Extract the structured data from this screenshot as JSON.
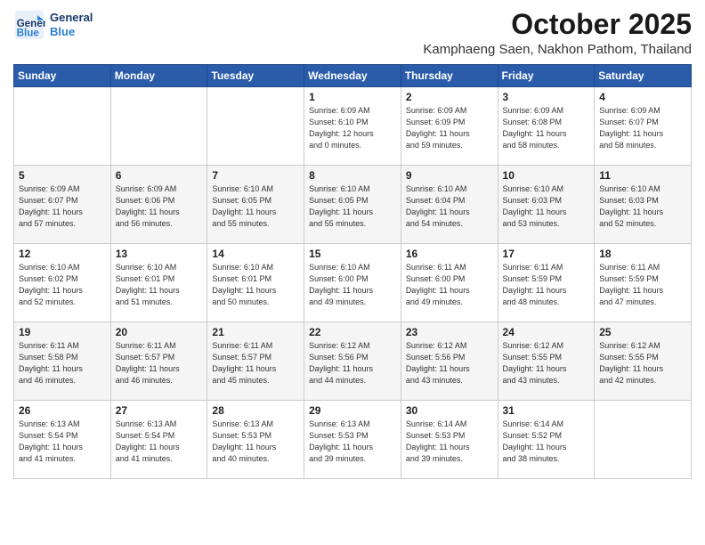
{
  "header": {
    "logo_line1": "General",
    "logo_line2": "Blue",
    "title": "October 2025",
    "subtitle": "Kamphaeng Saen, Nakhon Pathom, Thailand"
  },
  "weekdays": [
    "Sunday",
    "Monday",
    "Tuesday",
    "Wednesday",
    "Thursday",
    "Friday",
    "Saturday"
  ],
  "weeks": [
    [
      {
        "num": "",
        "info": ""
      },
      {
        "num": "",
        "info": ""
      },
      {
        "num": "",
        "info": ""
      },
      {
        "num": "1",
        "info": "Sunrise: 6:09 AM\nSunset: 6:10 PM\nDaylight: 12 hours\nand 0 minutes."
      },
      {
        "num": "2",
        "info": "Sunrise: 6:09 AM\nSunset: 6:09 PM\nDaylight: 11 hours\nand 59 minutes."
      },
      {
        "num": "3",
        "info": "Sunrise: 6:09 AM\nSunset: 6:08 PM\nDaylight: 11 hours\nand 58 minutes."
      },
      {
        "num": "4",
        "info": "Sunrise: 6:09 AM\nSunset: 6:07 PM\nDaylight: 11 hours\nand 58 minutes."
      }
    ],
    [
      {
        "num": "5",
        "info": "Sunrise: 6:09 AM\nSunset: 6:07 PM\nDaylight: 11 hours\nand 57 minutes."
      },
      {
        "num": "6",
        "info": "Sunrise: 6:09 AM\nSunset: 6:06 PM\nDaylight: 11 hours\nand 56 minutes."
      },
      {
        "num": "7",
        "info": "Sunrise: 6:10 AM\nSunset: 6:05 PM\nDaylight: 11 hours\nand 55 minutes."
      },
      {
        "num": "8",
        "info": "Sunrise: 6:10 AM\nSunset: 6:05 PM\nDaylight: 11 hours\nand 55 minutes."
      },
      {
        "num": "9",
        "info": "Sunrise: 6:10 AM\nSunset: 6:04 PM\nDaylight: 11 hours\nand 54 minutes."
      },
      {
        "num": "10",
        "info": "Sunrise: 6:10 AM\nSunset: 6:03 PM\nDaylight: 11 hours\nand 53 minutes."
      },
      {
        "num": "11",
        "info": "Sunrise: 6:10 AM\nSunset: 6:03 PM\nDaylight: 11 hours\nand 52 minutes."
      }
    ],
    [
      {
        "num": "12",
        "info": "Sunrise: 6:10 AM\nSunset: 6:02 PM\nDaylight: 11 hours\nand 52 minutes."
      },
      {
        "num": "13",
        "info": "Sunrise: 6:10 AM\nSunset: 6:01 PM\nDaylight: 11 hours\nand 51 minutes."
      },
      {
        "num": "14",
        "info": "Sunrise: 6:10 AM\nSunset: 6:01 PM\nDaylight: 11 hours\nand 50 minutes."
      },
      {
        "num": "15",
        "info": "Sunrise: 6:10 AM\nSunset: 6:00 PM\nDaylight: 11 hours\nand 49 minutes."
      },
      {
        "num": "16",
        "info": "Sunrise: 6:11 AM\nSunset: 6:00 PM\nDaylight: 11 hours\nand 49 minutes."
      },
      {
        "num": "17",
        "info": "Sunrise: 6:11 AM\nSunset: 5:59 PM\nDaylight: 11 hours\nand 48 minutes."
      },
      {
        "num": "18",
        "info": "Sunrise: 6:11 AM\nSunset: 5:59 PM\nDaylight: 11 hours\nand 47 minutes."
      }
    ],
    [
      {
        "num": "19",
        "info": "Sunrise: 6:11 AM\nSunset: 5:58 PM\nDaylight: 11 hours\nand 46 minutes."
      },
      {
        "num": "20",
        "info": "Sunrise: 6:11 AM\nSunset: 5:57 PM\nDaylight: 11 hours\nand 46 minutes."
      },
      {
        "num": "21",
        "info": "Sunrise: 6:11 AM\nSunset: 5:57 PM\nDaylight: 11 hours\nand 45 minutes."
      },
      {
        "num": "22",
        "info": "Sunrise: 6:12 AM\nSunset: 5:56 PM\nDaylight: 11 hours\nand 44 minutes."
      },
      {
        "num": "23",
        "info": "Sunrise: 6:12 AM\nSunset: 5:56 PM\nDaylight: 11 hours\nand 43 minutes."
      },
      {
        "num": "24",
        "info": "Sunrise: 6:12 AM\nSunset: 5:55 PM\nDaylight: 11 hours\nand 43 minutes."
      },
      {
        "num": "25",
        "info": "Sunrise: 6:12 AM\nSunset: 5:55 PM\nDaylight: 11 hours\nand 42 minutes."
      }
    ],
    [
      {
        "num": "26",
        "info": "Sunrise: 6:13 AM\nSunset: 5:54 PM\nDaylight: 11 hours\nand 41 minutes."
      },
      {
        "num": "27",
        "info": "Sunrise: 6:13 AM\nSunset: 5:54 PM\nDaylight: 11 hours\nand 41 minutes."
      },
      {
        "num": "28",
        "info": "Sunrise: 6:13 AM\nSunset: 5:53 PM\nDaylight: 11 hours\nand 40 minutes."
      },
      {
        "num": "29",
        "info": "Sunrise: 6:13 AM\nSunset: 5:53 PM\nDaylight: 11 hours\nand 39 minutes."
      },
      {
        "num": "30",
        "info": "Sunrise: 6:14 AM\nSunset: 5:53 PM\nDaylight: 11 hours\nand 39 minutes."
      },
      {
        "num": "31",
        "info": "Sunrise: 6:14 AM\nSunset: 5:52 PM\nDaylight: 11 hours\nand 38 minutes."
      },
      {
        "num": "",
        "info": ""
      }
    ]
  ]
}
